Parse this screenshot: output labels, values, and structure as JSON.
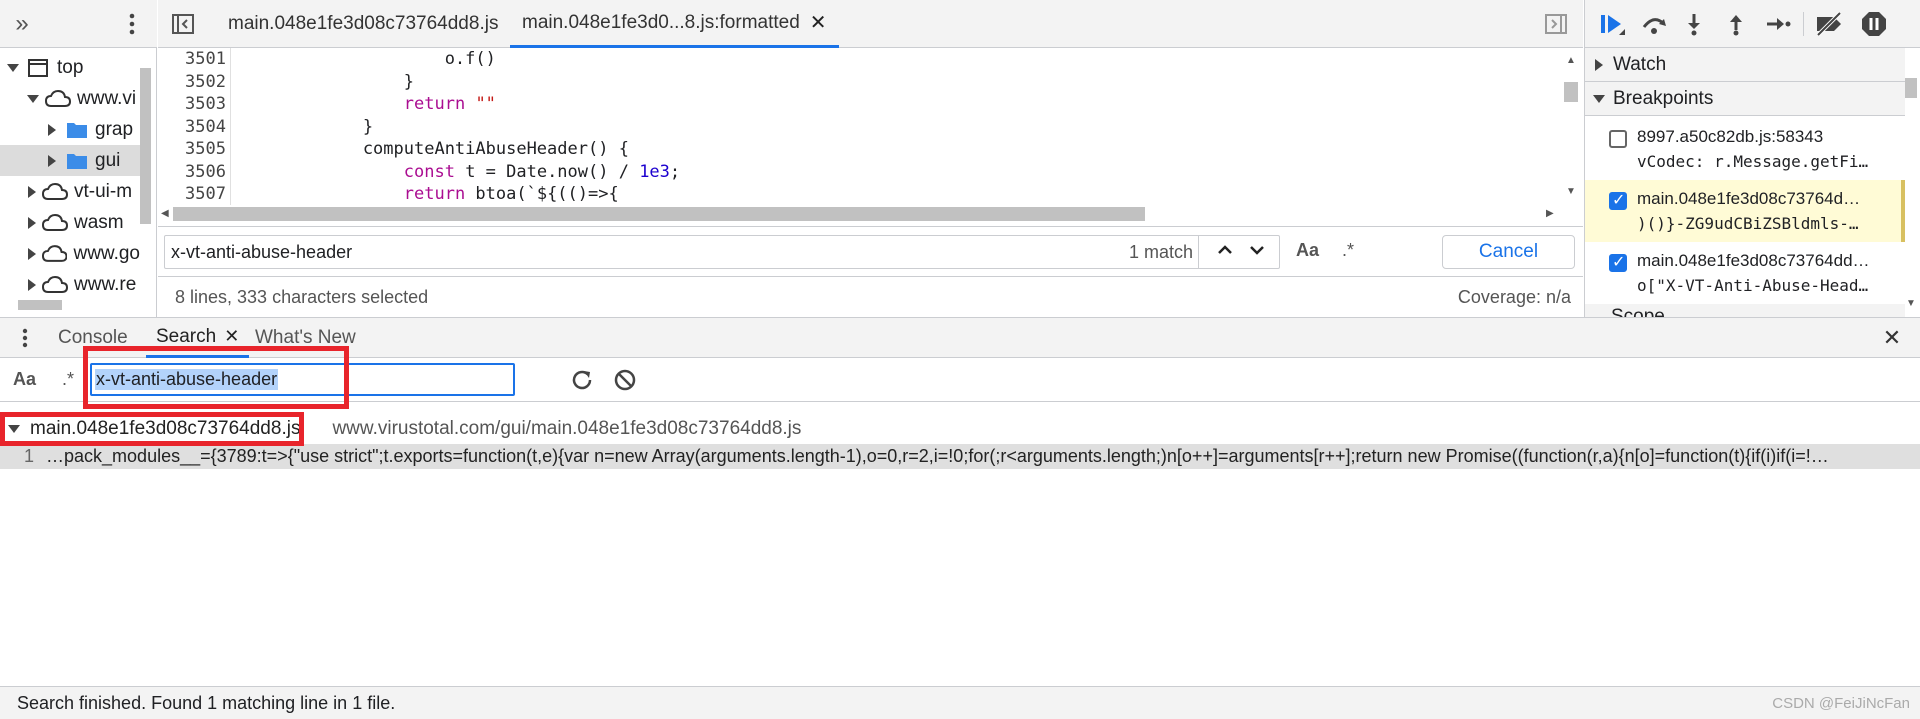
{
  "navigator": {
    "tree": [
      {
        "label": "top",
        "type": "frame"
      },
      {
        "label": "www.vi",
        "type": "cloud"
      },
      {
        "label": "grap",
        "type": "folder"
      },
      {
        "label": "gui",
        "type": "folder"
      },
      {
        "label": "vt-ui-m",
        "type": "cloud"
      },
      {
        "label": "wasm",
        "type": "cloud"
      },
      {
        "label": "www.go",
        "type": "cloud"
      },
      {
        "label": "www.re",
        "type": "cloud"
      }
    ]
  },
  "editor": {
    "tabs": [
      {
        "label": "main.048e1fe3d08c73764dd8.js"
      },
      {
        "label": "main.048e1fe3d0...8.js:formatted"
      }
    ],
    "lines": [
      {
        "num": "3501",
        "parts": [
          {
            "t": "                    o.f()",
            "c": ""
          }
        ]
      },
      {
        "num": "3502",
        "parts": [
          {
            "t": "                }",
            "c": ""
          }
        ]
      },
      {
        "num": "3503",
        "parts": [
          {
            "t": "                ",
            "c": ""
          },
          {
            "t": "return",
            "c": "kw"
          },
          {
            "t": " ",
            "c": ""
          },
          {
            "t": "\"\"",
            "c": "str"
          }
        ]
      },
      {
        "num": "3504",
        "parts": [
          {
            "t": "            }",
            "c": ""
          }
        ]
      },
      {
        "num": "3505",
        "parts": [
          {
            "t": "            computeAntiAbuseHeader() {",
            "c": ""
          }
        ]
      },
      {
        "num": "3506",
        "parts": [
          {
            "t": "                ",
            "c": ""
          },
          {
            "t": "const",
            "c": "kw"
          },
          {
            "t": " t = Date.now() / ",
            "c": ""
          },
          {
            "t": "1e3",
            "c": "num"
          },
          {
            "t": ";",
            "c": ""
          }
        ]
      },
      {
        "num": "3507",
        "parts": [
          {
            "t": "                ",
            "c": ""
          },
          {
            "t": "return",
            "c": "kw"
          },
          {
            "t": " btoa(`${(()=>{",
            "c": ""
          }
        ]
      }
    ],
    "find": {
      "query": "x-vt-anti-abuse-header",
      "match_count": "1 match",
      "case_label": "Aa",
      "regex_label": ".*",
      "cancel_label": "Cancel"
    },
    "status": {
      "selection": "8 lines, 333 characters selected",
      "coverage": "Coverage: n/a"
    }
  },
  "debugger": {
    "watch_label": "Watch",
    "breakpoints_label": "Breakpoints",
    "scope_label": "Scope",
    "breakpoints": [
      {
        "file": "8997.a50c82db.js:58343",
        "code": "vCodec: r.Message.getFi…",
        "checked": false,
        "highlighted": false
      },
      {
        "file": "main.048e1fe3d08c73764d…",
        "code": ")()}-ZG9udCBiZSBldmls-…",
        "checked": true,
        "highlighted": true
      },
      {
        "file": "main.048e1fe3d08c73764dd…",
        "code": "o[\"X-VT-Anti-Abuse-Head…",
        "checked": true,
        "highlighted": false
      }
    ]
  },
  "drawer": {
    "tabs": [
      {
        "label": "Console"
      },
      {
        "label": "Search"
      },
      {
        "label": "What's New"
      }
    ],
    "search": {
      "case_label": "Aa",
      "regex_label": ".*",
      "query": "x-vt-anti-abuse-header"
    },
    "results": {
      "file_name": "main.048e1fe3d08c73764dd8.js",
      "file_url": "www.virustotal.com/gui/main.048e1fe3d08c73764dd8.js",
      "match_line_num": "1",
      "match_text": "…pack_modules__={3789:t=>{\"use strict\";t.exports=function(t,e){var n=new Array(arguments.length-1),o=0,r=2,i=!0;for(;r<arguments.length;)n[o++]=arguments[r++];return new Promise((function(r,a){n[o]=function(t){if(i)if(i=!…"
    },
    "footer_status": "Search finished.  Found 1 matching line in 1 file.",
    "watermark": "CSDN @FeiJiNcFan"
  },
  "colors": {
    "accent": "#1a73e8",
    "highlight_box": "#e8242b",
    "breakpoint_highlight": "#fffbd6",
    "keyword": "#aa0d91",
    "string": "#c41a16",
    "number": "#1c00cf"
  }
}
